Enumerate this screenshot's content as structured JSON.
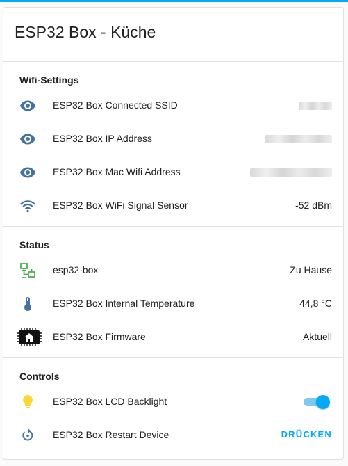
{
  "card": {
    "title": "ESP32 Box - Küche"
  },
  "sections": {
    "wifi": {
      "title": "Wifi-Settings",
      "rows": [
        {
          "name": "ESP32 Box Connected SSID",
          "icon": "eye-icon",
          "value": ""
        },
        {
          "name": "ESP32 Box IP Address",
          "icon": "eye-icon",
          "value": ""
        },
        {
          "name": "ESP32 Box Mac Wifi Address",
          "icon": "eye-icon",
          "value": ""
        },
        {
          "name": "ESP32 Box WiFi Signal Sensor",
          "icon": "wifi-icon",
          "value": "-52 dBm"
        }
      ]
    },
    "status": {
      "title": "Status",
      "rows": [
        {
          "name": "esp32-box",
          "icon": "network-icon",
          "value": "Zu Hause"
        },
        {
          "name": "ESP32 Box Internal Temperature",
          "icon": "thermometer-icon",
          "value": "44,8 °C"
        },
        {
          "name": "ESP32 Box Firmware",
          "icon": "chip-home-icon",
          "value": "Aktuell"
        }
      ]
    },
    "controls": {
      "title": "Controls",
      "rows": [
        {
          "name": "ESP32 Box LCD Backlight",
          "icon": "lightbulb-icon",
          "state": "on"
        },
        {
          "name": "ESP32 Box Restart Device",
          "icon": "restart-icon",
          "action_label": "DRÜCKEN"
        }
      ]
    }
  },
  "colors": {
    "accent": "#03a9f4",
    "icon_blue": "#44739e",
    "network_green": "#4caf50",
    "bulb_yellow": "#fdd835"
  }
}
